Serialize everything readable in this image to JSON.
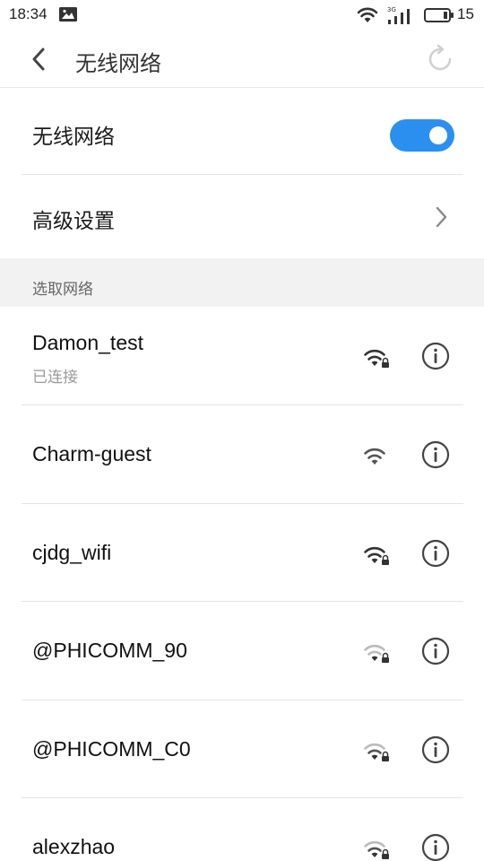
{
  "status_bar": {
    "time": "18:34",
    "battery_percent": "15",
    "notification_icon": "image-notification-icon",
    "wifi_icon": "wifi-status-icon",
    "signal_icon": "cellular-3g-signal-icon",
    "battery_icon": "battery-icon"
  },
  "header": {
    "back_icon": "back-arrow-icon",
    "title": "无线网络",
    "refresh_icon": "refresh-icon"
  },
  "wifi_toggle": {
    "label": "无线网络",
    "enabled": true,
    "accent": "#2b8ff0"
  },
  "advanced": {
    "label": "高级设置"
  },
  "section": {
    "label": "选取网络"
  },
  "networks": [
    {
      "ssid": "Damon_test",
      "status": "已连接",
      "secured": true,
      "strength": "full"
    },
    {
      "ssid": "Charm-guest",
      "status": "",
      "secured": false,
      "strength": "full-light"
    },
    {
      "ssid": "cjdg_wifi",
      "status": "",
      "secured": true,
      "strength": "full"
    },
    {
      "ssid": "@PHICOMM_90",
      "status": "",
      "secured": true,
      "strength": "weak"
    },
    {
      "ssid": "@PHICOMM_C0",
      "status": "",
      "secured": true,
      "strength": "weak"
    },
    {
      "ssid": "alexzhao",
      "status": "",
      "secured": true,
      "strength": "weak"
    }
  ]
}
